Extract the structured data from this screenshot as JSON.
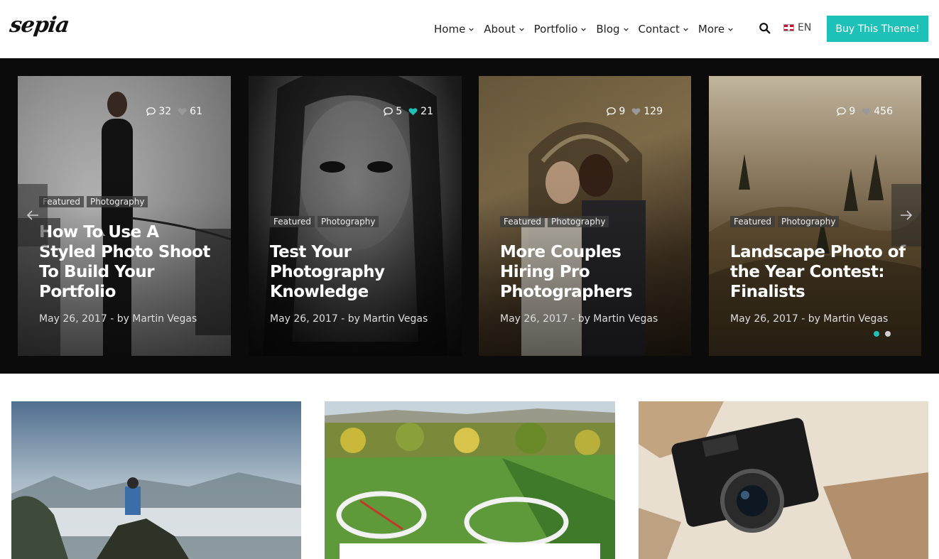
{
  "brand": {
    "logo_text": "sepia"
  },
  "nav": {
    "items": [
      {
        "label": "Home"
      },
      {
        "label": "About"
      },
      {
        "label": "Portfolio"
      },
      {
        "label": "Blog"
      },
      {
        "label": "Contact"
      },
      {
        "label": "More"
      }
    ],
    "language": "EN",
    "buy_label": "Buy This Theme!"
  },
  "icons": {
    "search": "search-icon",
    "chevron": "chevron-down-icon",
    "comment": "comment-icon",
    "heart": "heart-icon",
    "prev": "arrow-left-icon",
    "next": "arrow-right-icon"
  },
  "colors": {
    "accent": "#1ec1b8",
    "slider_bg": "#0b0b0b"
  },
  "slider": {
    "cards": [
      {
        "comments": "32",
        "likes": "61",
        "liked": false,
        "tags": [
          "Featured",
          "Photography"
        ],
        "title": "How To Use A Styled Photo Shoot To Build Your Portfolio",
        "meta": "May 26, 2017 - by Martin Vegas"
      },
      {
        "comments": "5",
        "likes": "21",
        "liked": true,
        "tags": [
          "Featured",
          "Photography"
        ],
        "title": "Test Your Photography Knowledge",
        "meta": "May 26, 2017 - by Martin Vegas"
      },
      {
        "comments": "9",
        "likes": "129",
        "liked": false,
        "tags": [
          "Featured",
          "Photography"
        ],
        "title": "More Couples Hiring Pro Photographers",
        "meta": "May 26, 2017 - by Martin Vegas"
      },
      {
        "comments": "9",
        "likes": "456",
        "liked": false,
        "tags": [
          "Featured",
          "Photography"
        ],
        "title": "Landscape Photo of the Year Contest: Finalists",
        "meta": "May 26, 2017 - by Martin Vegas"
      }
    ],
    "active_dot": 0,
    "dot_count": 2
  }
}
